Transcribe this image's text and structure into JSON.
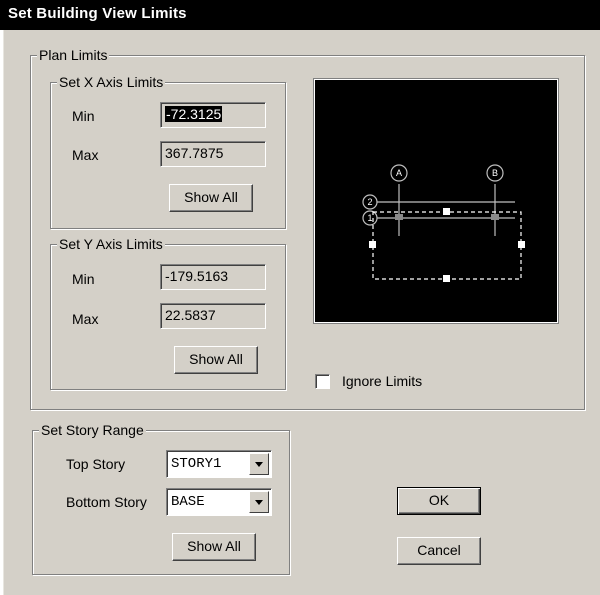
{
  "window": {
    "title": "Set Building View Limits"
  },
  "plan_limits": {
    "legend": "Plan Limits",
    "x_axis": {
      "legend": "Set X Axis Limits",
      "min_label": "Min",
      "min_value": "-72.3125",
      "max_label": "Max",
      "max_value": "367.7875",
      "show_all": "Show All"
    },
    "y_axis": {
      "legend": "Set Y Axis Limits",
      "min_label": "Min",
      "min_value": "-179.5163",
      "max_label": "Max",
      "max_value": "22.5837",
      "show_all": "Show All"
    },
    "preview": {
      "grid_col_1": "A",
      "grid_col_2": "B",
      "grid_row_1": "2",
      "grid_row_2": "1"
    },
    "ignore_limits": {
      "label": "Ignore Limits",
      "checked": false
    }
  },
  "story_range": {
    "legend": "Set Story Range",
    "top_label": "Top Story",
    "top_value": "STORY1",
    "bottom_label": "Bottom Story",
    "bottom_value": "BASE",
    "show_all": "Show All"
  },
  "buttons": {
    "ok": "OK",
    "cancel": "Cancel"
  },
  "colors": {
    "background": "#d4d0c8",
    "titlebar": "#000000",
    "preview_bg": "#000000"
  }
}
